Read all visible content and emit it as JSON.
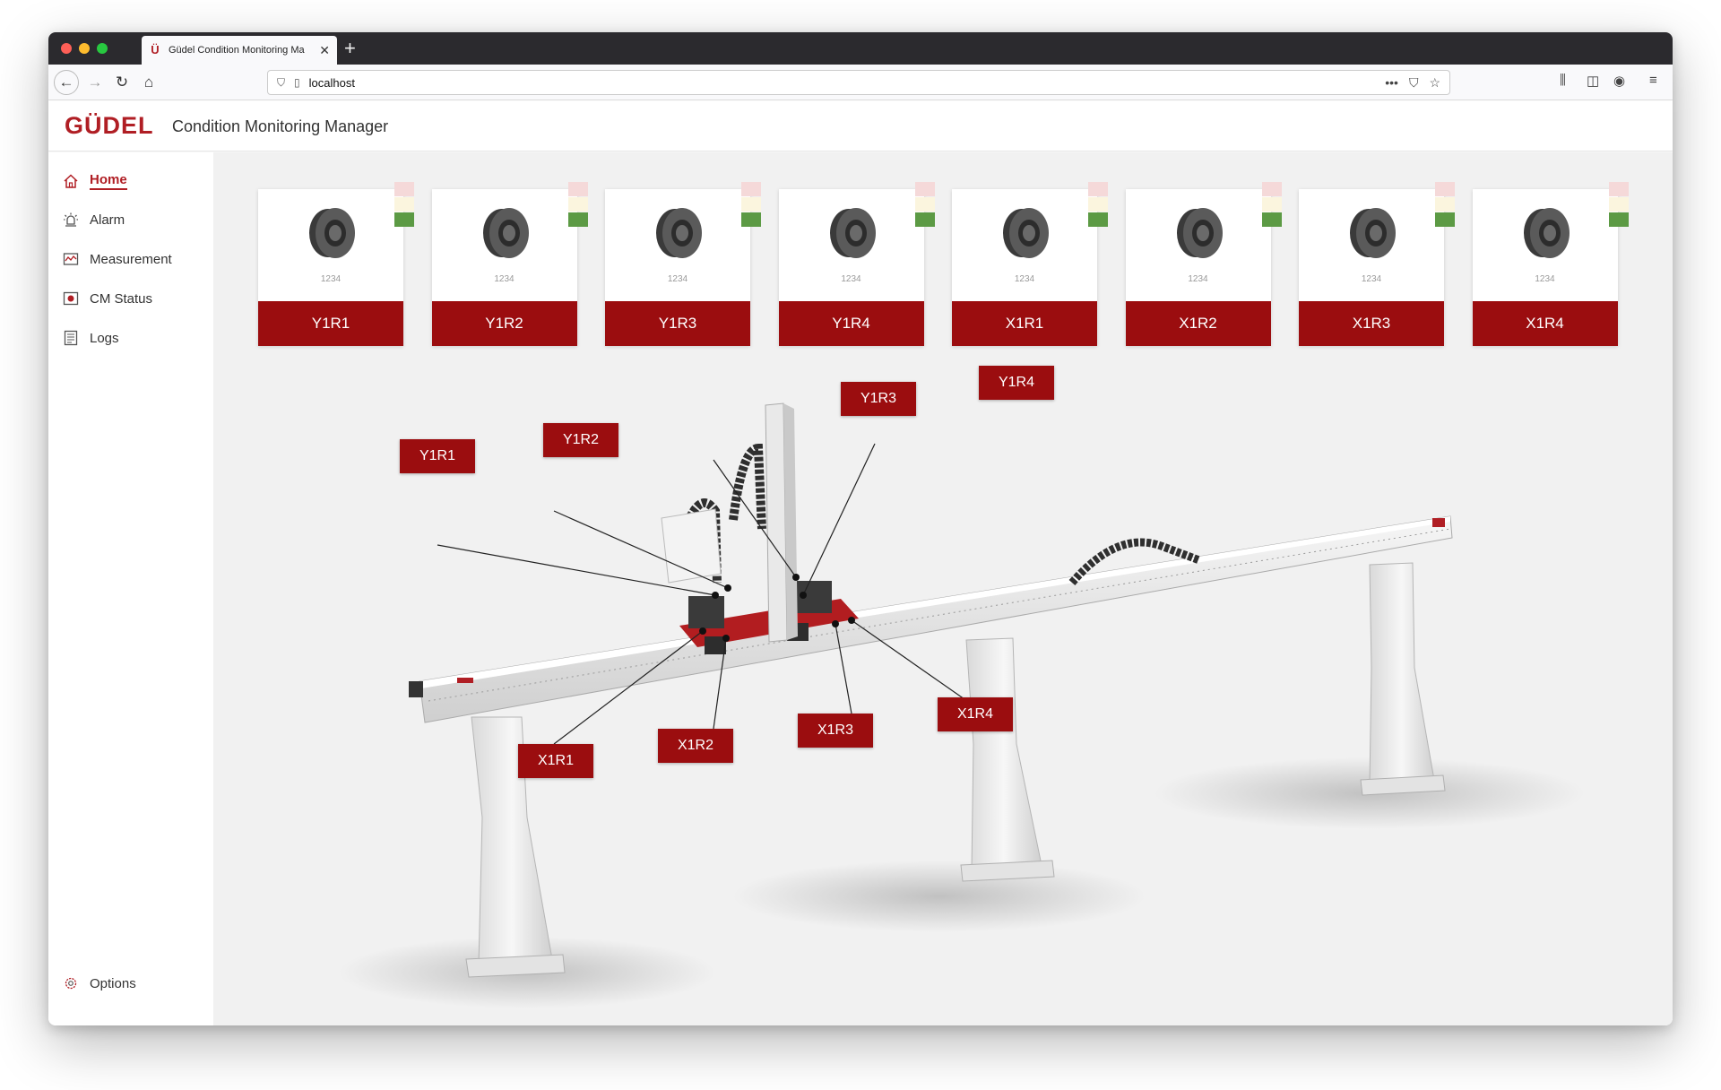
{
  "browser": {
    "tab_title": "Güdel Condition Monitoring Ma",
    "new_tab_symbol": "+",
    "close_symbol": "✕",
    "url": "localhost"
  },
  "header": {
    "logo": "GÜDEL",
    "title": "Condition Monitoring Manager"
  },
  "sidebar": {
    "items": [
      {
        "label": "Home",
        "icon": "home-icon",
        "active": true
      },
      {
        "label": "Alarm",
        "icon": "alarm-icon"
      },
      {
        "label": "Measurement",
        "icon": "measurement-icon"
      },
      {
        "label": "CM Status",
        "icon": "cm-status-icon"
      },
      {
        "label": "Logs",
        "icon": "logs-icon"
      }
    ],
    "options_label": "Options"
  },
  "sensors": [
    {
      "label": "Y1R1",
      "code": "1234",
      "status": "green"
    },
    {
      "label": "Y1R2",
      "code": "1234",
      "status": "green"
    },
    {
      "label": "Y1R3",
      "code": "1234",
      "status": "green"
    },
    {
      "label": "Y1R4",
      "code": "1234",
      "status": "green"
    },
    {
      "label": "X1R1",
      "code": "1234",
      "status": "green"
    },
    {
      "label": "X1R2",
      "code": "1234",
      "status": "green"
    },
    {
      "label": "X1R3",
      "code": "1234",
      "status": "green"
    },
    {
      "label": "X1R4",
      "code": "1234",
      "status": "green"
    }
  ],
  "callouts": [
    "Y1R1",
    "Y1R2",
    "Y1R3",
    "Y1R4",
    "X1R1",
    "X1R2",
    "X1R3",
    "X1R4"
  ],
  "colors": {
    "brand": "#b01e24",
    "label_bg": "#9b0d0f",
    "status_green": "#5c9a44",
    "status_yellow": "#fbf5de",
    "status_red": "#f5d9d9"
  }
}
